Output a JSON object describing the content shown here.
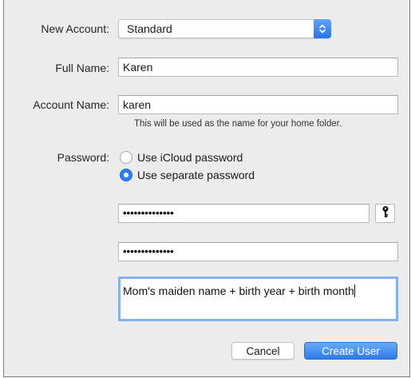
{
  "form": {
    "new_account_label": "New Account:",
    "new_account_value": "Standard",
    "full_name_label": "Full Name:",
    "full_name_value": "Karen",
    "account_name_label": "Account Name:",
    "account_name_value": "karen",
    "account_name_hint": "This will be used as the name for your home folder.",
    "password_label": "Password:",
    "password_options": [
      {
        "label": "Use iCloud password",
        "selected": false
      },
      {
        "label": "Use separate password",
        "selected": true
      }
    ],
    "password_value": "••••••••••••••",
    "verify_value": "••••••••••••••",
    "password_hint_value": "Mom's maiden name + birth year + birth month"
  },
  "buttons": {
    "cancel": "Cancel",
    "create": "Create User"
  },
  "icons": {
    "popup_arrows": "up-down-chevron-icon",
    "password_assistant": "key-icon"
  },
  "colors": {
    "accent": "#2d7be9",
    "focus_ring": "#83b2ee",
    "dialog_bg": "#ececec"
  }
}
